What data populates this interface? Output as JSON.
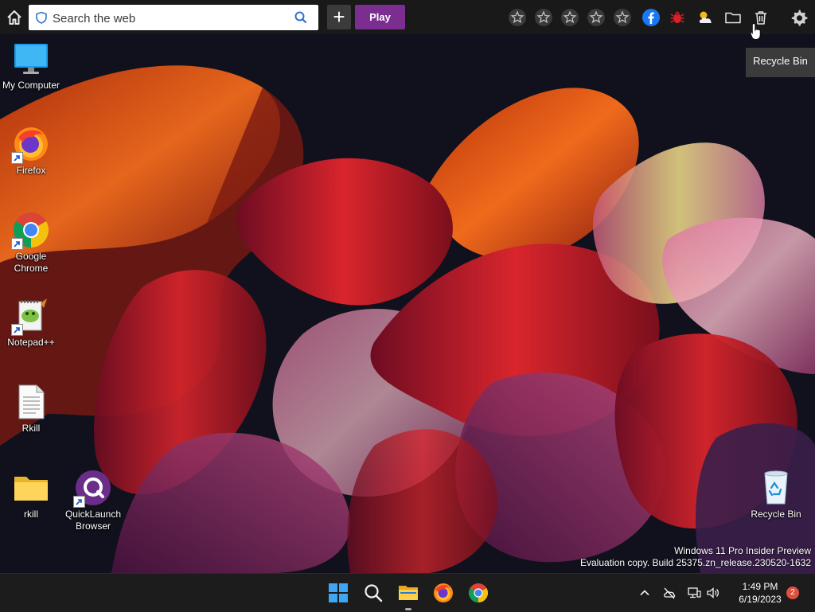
{
  "toolbar": {
    "search_placeholder": "Search the web",
    "play_label": "Play",
    "plus_label": "+",
    "icons": [
      "home-icon",
      "shield-icon",
      "search-icon",
      "star-icon",
      "star-icon",
      "star-icon",
      "star-icon",
      "star-icon",
      "facebook-icon",
      "bug-icon",
      "weather-icon",
      "folder-icon",
      "trash-icon",
      "gear-icon"
    ],
    "play_color": "#7b2d90"
  },
  "tooltip": {
    "text": "Recycle Bin"
  },
  "desktop": {
    "icons": [
      {
        "label": "My Computer",
        "icon": "monitor-icon"
      },
      {
        "label": "Firefox",
        "icon": "firefox-icon"
      },
      {
        "label": "Google Chrome",
        "icon": "chrome-icon"
      },
      {
        "label": "Notepad++",
        "icon": "notepadpp-icon"
      },
      {
        "label": "Rkill",
        "icon": "document-icon"
      },
      {
        "label": "rkill",
        "icon": "folder-icon"
      },
      {
        "label": "QuickLaunch Browser",
        "icon": "quicklaunch-icon"
      },
      {
        "label": "Recycle Bin",
        "icon": "recycle-bin-icon"
      }
    ]
  },
  "watermark": {
    "line1": "Windows 11 Pro Insider Preview",
    "line2": "Evaluation copy. Build 25375.zn_release.230520-1632"
  },
  "taskbar": {
    "apps": [
      "windows-start-icon",
      "search-icon",
      "file-explorer-icon",
      "firefox-icon",
      "chrome-icon"
    ],
    "time": "1:49 PM",
    "date": "6/19/2023",
    "notifications": "2"
  }
}
